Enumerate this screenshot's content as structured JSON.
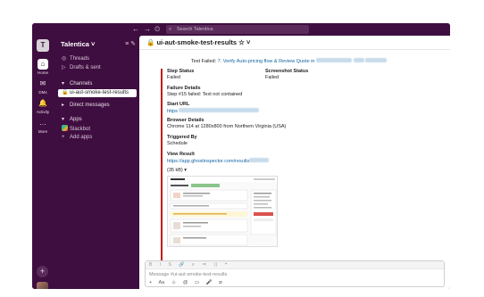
{
  "topbar": {
    "back_arrow": "←",
    "forward_arrow": "→",
    "history_icon": "⏲",
    "search_placeholder": "Search Talentica"
  },
  "rail": {
    "workspace_initial": "T",
    "items": [
      {
        "label": "Home",
        "icon": "⌂"
      },
      {
        "label": "DMs",
        "icon": "✉"
      },
      {
        "label": "Activity",
        "icon": "🔔"
      },
      {
        "label": "More",
        "icon": "…"
      }
    ],
    "plus": "+"
  },
  "sidebar": {
    "workspace_name": "Talentica ˅",
    "header_icons": "≡  ✎",
    "threads": "Threads",
    "drafts": "Drafts & sent",
    "channels_section": "Channels",
    "active_channel": "ui-aut-smoke-test-results",
    "direct_messages": "Direct messages",
    "apps_section": "Apps",
    "app_name": "Slackbot",
    "add_apps": "Add apps"
  },
  "channel": {
    "title": "ui-aut-smoke-test-results",
    "title_suffix": "☆ ˅"
  },
  "message": {
    "test_failed_prefix": "Test Failed: ",
    "test_failed_link": "7. Verify Auto-pricing flow & Review Quote in",
    "step_status_label": "Step Status",
    "step_status_value": "Failed",
    "screenshot_status_label": "Screenshot Status",
    "screenshot_status_value": "Failed",
    "failure_details_label": "Failure Details",
    "failure_details_value": "Step #15 failed: Text not contained",
    "start_url_label": "Start URL",
    "start_url_value": "https",
    "browser_details_label": "Browser Details",
    "browser_details_value": "Chrome 114 at 1280x800 from Northern Virginia (USA)",
    "triggered_by_label": "Triggered By",
    "triggered_by_value": "Schedule",
    "view_result_label": "View Result",
    "view_result_link": "https://app.ghostinspector.com/results",
    "file_size": "(35 kB) ▾"
  },
  "composer": {
    "placeholder": "Message #ui-aut-smoke-test-results",
    "format_icons": [
      "B",
      "I",
      "S",
      "🔗",
      "≡",
      "≔",
      "⟨⟩",
      "❝"
    ],
    "tool_icons": [
      "+",
      "Aa",
      "☺",
      "@",
      "▭",
      "🎤",
      "⧄"
    ]
  },
  "colors": {
    "aubergine": "#3f0e40",
    "link": "#1264a3",
    "attachment_bar": "#c41a1a"
  }
}
